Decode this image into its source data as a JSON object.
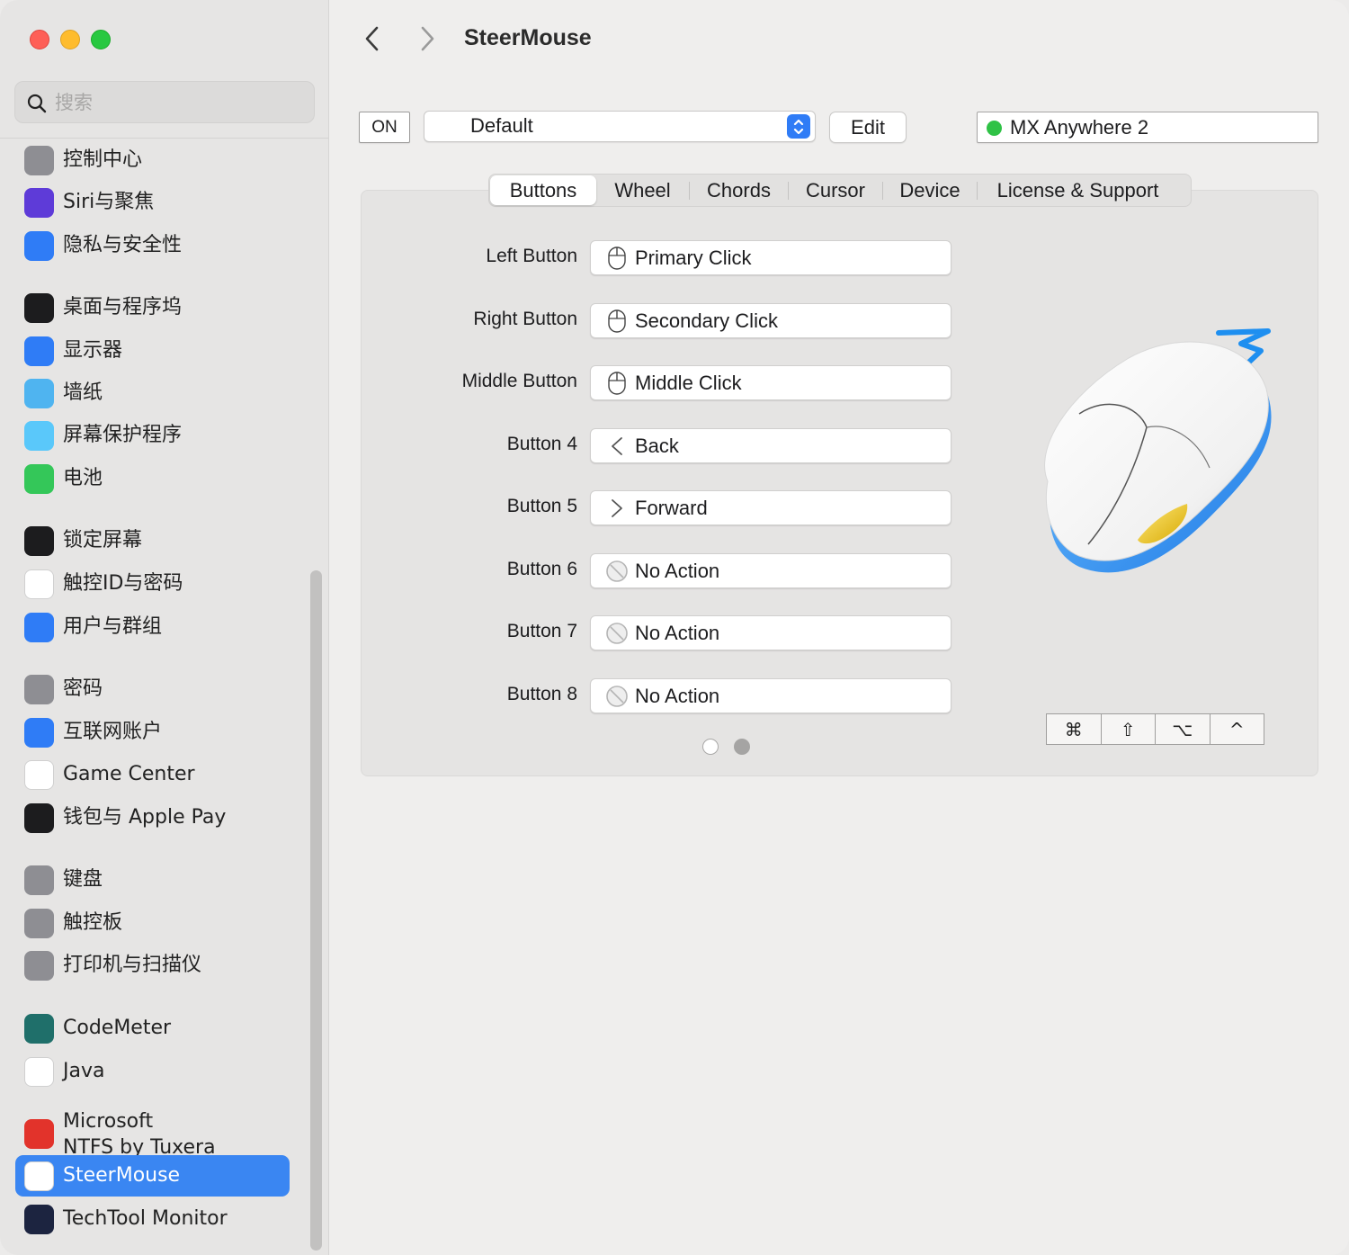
{
  "window": {
    "title": "SteerMouse"
  },
  "search": {
    "placeholder": "搜索"
  },
  "sidebar": {
    "items": [
      {
        "label": "控制中心",
        "icon": "control-center-icon",
        "color": "#8e8e93"
      },
      {
        "label": "Siri与聚焦",
        "icon": "siri-icon",
        "color": "#5e3bd8"
      },
      {
        "label": "隐私与安全性",
        "icon": "privacy-hand-icon",
        "color": "#2f7cf6"
      },
      {
        "label": "桌面与程序坞",
        "icon": "desktop-dock-icon",
        "color": "#1c1c1e"
      },
      {
        "label": "显示器",
        "icon": "display-brightness-icon",
        "color": "#2f7cf6"
      },
      {
        "label": "墙纸",
        "icon": "wallpaper-flower-icon",
        "color": "#4fb4f0"
      },
      {
        "label": "屏幕保护程序",
        "icon": "screensaver-icon",
        "color": "#5ac8fa"
      },
      {
        "label": "电池",
        "icon": "battery-icon",
        "color": "#34c759"
      },
      {
        "label": "锁定屏幕",
        "icon": "lock-screen-icon",
        "color": "#1c1c1e"
      },
      {
        "label": "触控ID与密码",
        "icon": "fingerprint-icon",
        "color": "#ffffff"
      },
      {
        "label": "用户与群组",
        "icon": "users-groups-icon",
        "color": "#2f7cf6"
      },
      {
        "label": "密码",
        "icon": "key-icon",
        "color": "#8e8e93"
      },
      {
        "label": "互联网账户",
        "icon": "at-sign-icon",
        "color": "#2f7cf6"
      },
      {
        "label": "Game Center",
        "icon": "game-center-icon",
        "color": "#ffffff"
      },
      {
        "label": "钱包与 Apple Pay",
        "icon": "wallet-icon",
        "color": "#1c1c1e"
      },
      {
        "label": "键盘",
        "icon": "keyboard-icon",
        "color": "#8e8e93"
      },
      {
        "label": "触控板",
        "icon": "trackpad-icon",
        "color": "#8e8e93"
      },
      {
        "label": "打印机与扫描仪",
        "icon": "printer-icon",
        "color": "#8e8e93"
      },
      {
        "label": "CodeMeter",
        "icon": "codemeter-icon",
        "color": "#1f6f6a"
      },
      {
        "label": "Java",
        "icon": "java-icon",
        "color": "#ffffff"
      },
      {
        "label_line1": "Microsoft",
        "label_line2": "NTFS by Tuxera",
        "icon": "tuxera-icon",
        "color": "#e2332b"
      },
      {
        "label": "SteerMouse",
        "icon": "steermouse-icon",
        "color": "#ffffff",
        "selected": true
      },
      {
        "label": "TechTool Monitor",
        "icon": "techtool-icon",
        "color": "#1c2440"
      }
    ]
  },
  "toolbar": {
    "on_label": "ON",
    "preset_value": "Default",
    "edit_label": "Edit",
    "device_name": "MX Anywhere 2",
    "device_status_color": "#2fc246"
  },
  "tabs": [
    "Buttons",
    "Wheel",
    "Chords",
    "Cursor",
    "Device",
    "License & Support"
  ],
  "active_tab": "Buttons",
  "buttons": [
    {
      "label": "Left Button",
      "action": "Primary Click",
      "icon": "mouse-icon"
    },
    {
      "label": "Right Button",
      "action": "Secondary Click",
      "icon": "mouse-icon"
    },
    {
      "label": "Middle Button",
      "action": "Middle Click",
      "icon": "mouse-icon"
    },
    {
      "label": "Button 4",
      "action": "Back",
      "icon": "chevron-left-icon"
    },
    {
      "label": "Button 5",
      "action": "Forward",
      "icon": "chevron-right-icon"
    },
    {
      "label": "Button 6",
      "action": "No Action",
      "icon": "no-action-icon"
    },
    {
      "label": "Button 7",
      "action": "No Action",
      "icon": "no-action-icon"
    },
    {
      "label": "Button 8",
      "action": "No Action",
      "icon": "no-action-icon"
    }
  ],
  "pagination": {
    "pages": 2,
    "current": 1
  },
  "modifiers": [
    "⌘",
    "⇧",
    "⌥",
    "^"
  ],
  "accent_color": "#2f7cf6"
}
